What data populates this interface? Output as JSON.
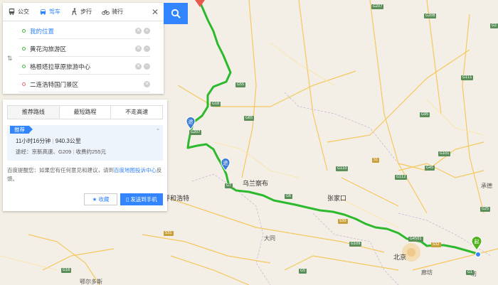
{
  "tabs": [
    {
      "label": "公交",
      "icon": "bus-icon",
      "active": false
    },
    {
      "label": "驾车",
      "icon": "car-icon",
      "active": true
    },
    {
      "label": "步行",
      "icon": "walk-icon",
      "active": false
    },
    {
      "label": "骑行",
      "icon": "bike-icon",
      "active": false
    }
  ],
  "stops": [
    {
      "label": "我的位置"
    },
    {
      "label": "黄花沟旅游区"
    },
    {
      "label": "格根塔拉草原旅游中心"
    },
    {
      "label": "二连浩特国门景区"
    }
  ],
  "route_tabs": [
    "推荐路线",
    "最短路程",
    "不走高速"
  ],
  "route": {
    "tag": "推荐",
    "time": "11小时16分钟",
    "distance": "940.3公里",
    "via_label": "途经：",
    "via": "京新高速、G209",
    "toll": "收费约255元"
  },
  "feedback": {
    "prefix": "百度提醒您：如果您有任何意见和建议，请到",
    "link": "百度地图投诉中心",
    "suffix": "反馈。"
  },
  "buttons": {
    "favorite": "收藏",
    "send": "发送到手机"
  },
  "map": {
    "cities": {
      "wulanchabu": "乌兰察布",
      "zhangjiakou": "张家口",
      "beijing": "北京",
      "hohhot": "呼和浩特",
      "datong": "大同",
      "chengde": "承德",
      "langfang": "廊坊",
      "eerduosi": "鄂尔多斯",
      "weifang": "坊"
    },
    "markers": {
      "via": "途",
      "start": "起"
    },
    "shields": [
      "G207",
      "G208",
      "G55",
      "G6",
      "G1",
      "G95",
      "G112",
      "G110",
      "G4501",
      "G45",
      "G101",
      "G25",
      "G109",
      "G18",
      "G5",
      "G2",
      "G111",
      "G207",
      "S30",
      "S31",
      "S32",
      "S1",
      "G18",
      "G65",
      "G7"
    ]
  },
  "colors": {
    "accent": "#3385ff",
    "route": "#2db92d",
    "via_pin": "#3b7bd6",
    "start_pin": "#52b21d"
  }
}
